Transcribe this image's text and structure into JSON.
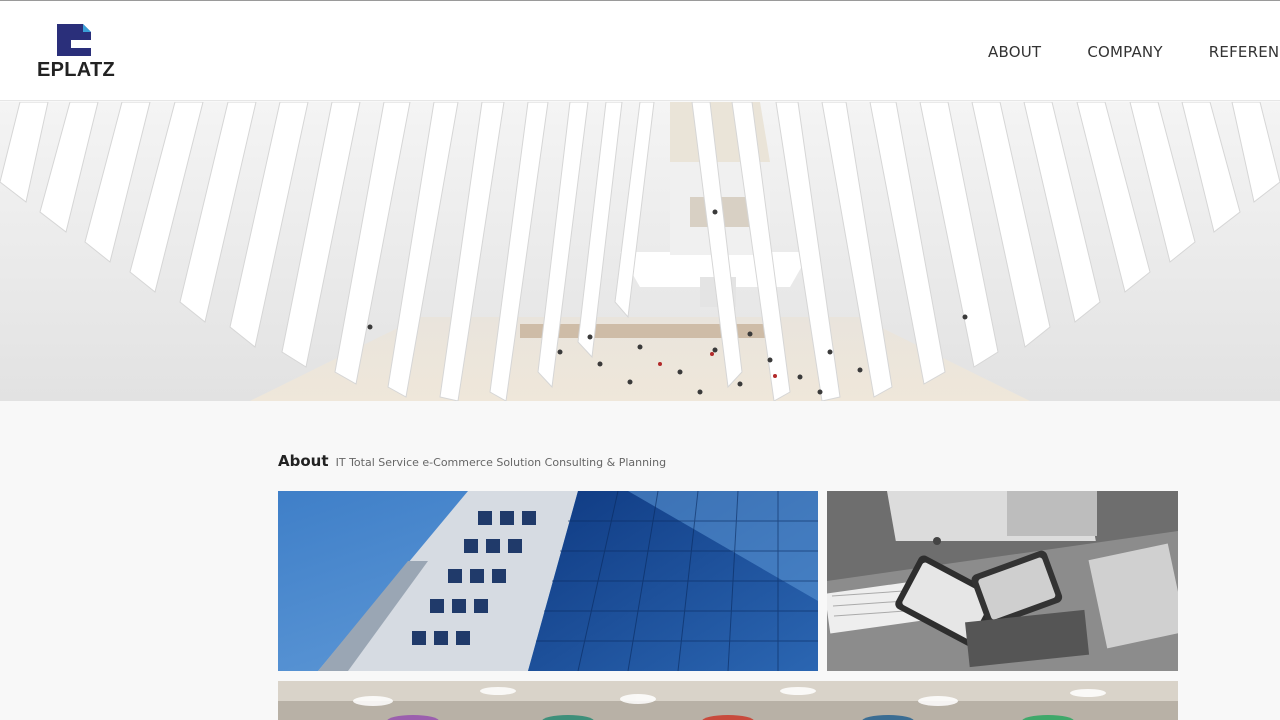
{
  "brand": {
    "name": "EPLATZ",
    "logo_colors": {
      "primary": "#2a2f7a",
      "accent": "#3aa0d8"
    }
  },
  "nav": {
    "items": [
      {
        "label": "ABOUT"
      },
      {
        "label": "COMPANY"
      },
      {
        "label": "REFERENCE"
      }
    ]
  },
  "hero": {
    "image": "station-interior-white-ribs"
  },
  "about": {
    "title": "About",
    "subtitle": "IT Total Service e-Commerce Solution Consulting & Planning",
    "photos": [
      {
        "image": "glass-office-building"
      },
      {
        "image": "computer-devices-monochrome"
      },
      {
        "image": "office-interior-colored-chairs"
      }
    ]
  }
}
